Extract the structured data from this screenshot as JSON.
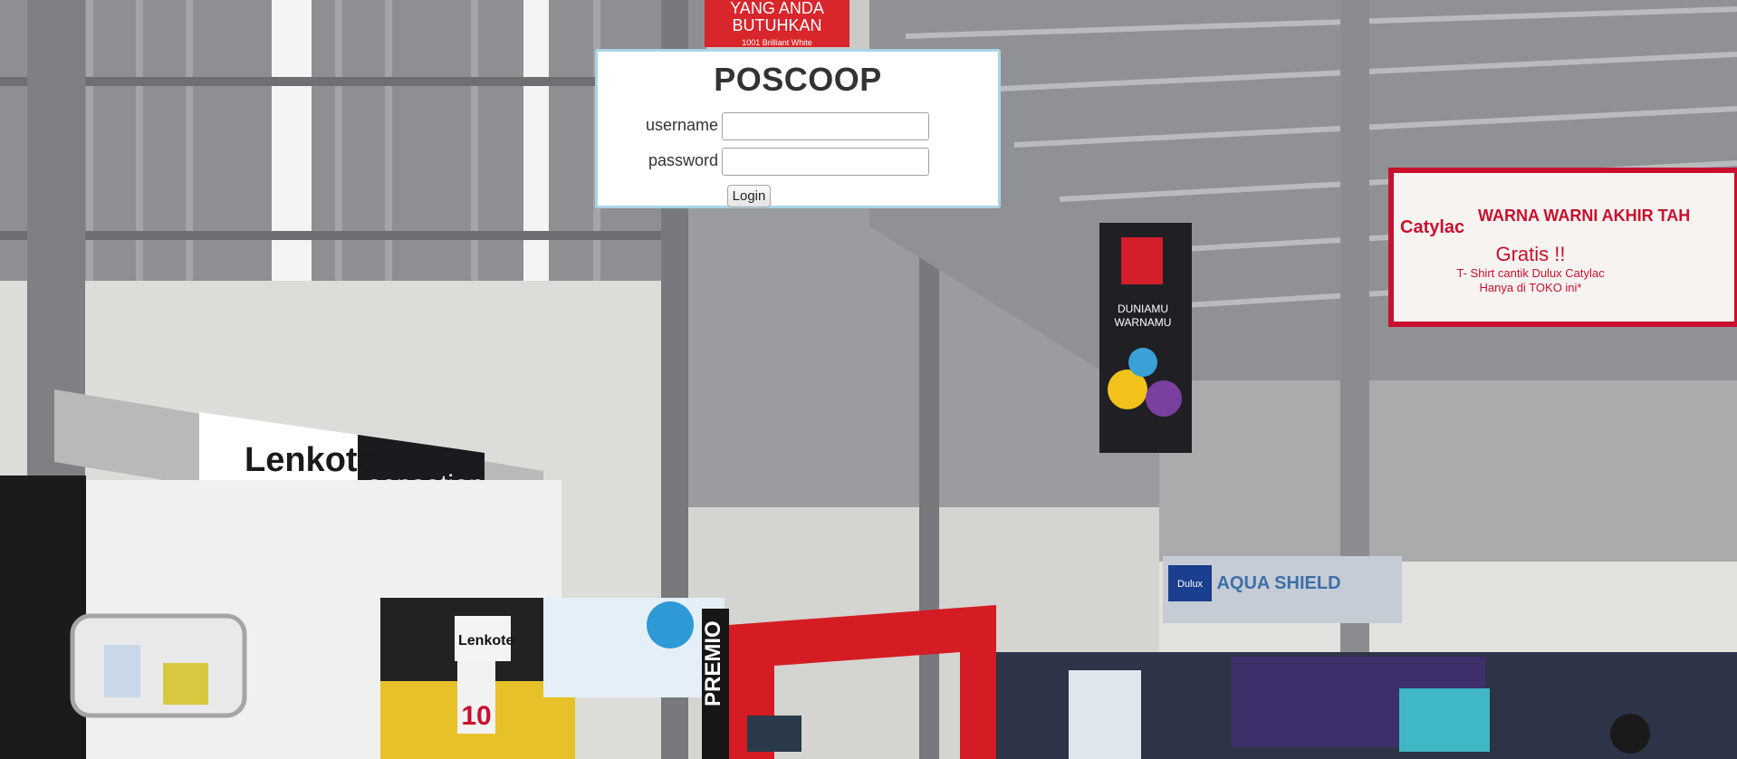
{
  "login": {
    "title": "POSCOOP",
    "username_label": "username",
    "password_label": "password",
    "username_value": "",
    "password_value": "",
    "login_button": "Login"
  },
  "background": {
    "banner_top": [
      "YANG ANDA",
      "BUTUHKAN",
      "1001 Brilliant White"
    ],
    "lenkote_brand": "Lenkote",
    "sensation_brand": "sensation",
    "nippon_banner": [
      "DUNIAMU",
      "WARNAMU"
    ],
    "catylac_brand": "Catylac",
    "catylac_headline": "WARNA WARNI AKHIR TAH",
    "catylac_gratis": "Gratis !!",
    "catylac_line1": "T- Shirt cantik Dulux Catylac",
    "catylac_line2": "Hanya di TOKO ini*",
    "dulux_brand": "Dulux",
    "aqua_shield": "AQUA SHIELD",
    "premio_brand": "PREMIO",
    "small_lenkote": "Lenkote",
    "discount": "10"
  }
}
